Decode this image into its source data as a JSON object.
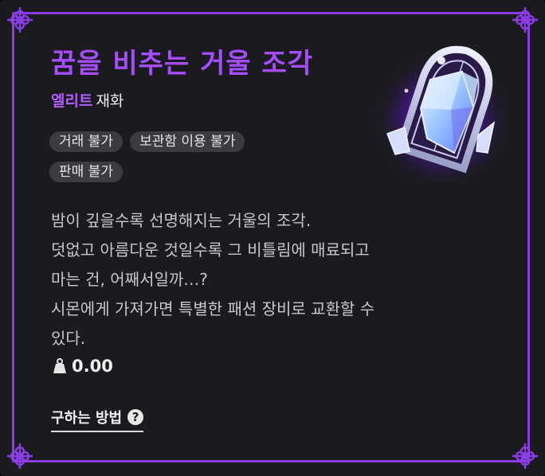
{
  "item": {
    "name": "꿈을 비추는 거울 조각",
    "grade": "엘리트",
    "category": "재화",
    "tags": [
      "거래 불가",
      "보관함 이용 불가",
      "판매 불가"
    ],
    "description": [
      "밤이 깊을수록 선명해지는 거울의 조각.",
      "덧없고 아름다운 것일수록 그 비틀림에 매료되고",
      "마는 건, 어째서일까…?",
      "시몬에게 가져가면 특별한 패션 장비로 교환할 수",
      "있다."
    ],
    "weight": "0.00",
    "acquire_label": "구하는 방법",
    "help_glyph": "?",
    "icon": "mirror-shard-icon",
    "weight_icon": "weight-icon"
  },
  "colors": {
    "accent": "#a64dff",
    "frame": "#8a3de6",
    "background": "#1b1b1f",
    "tag_bg": "#3a3c42"
  }
}
